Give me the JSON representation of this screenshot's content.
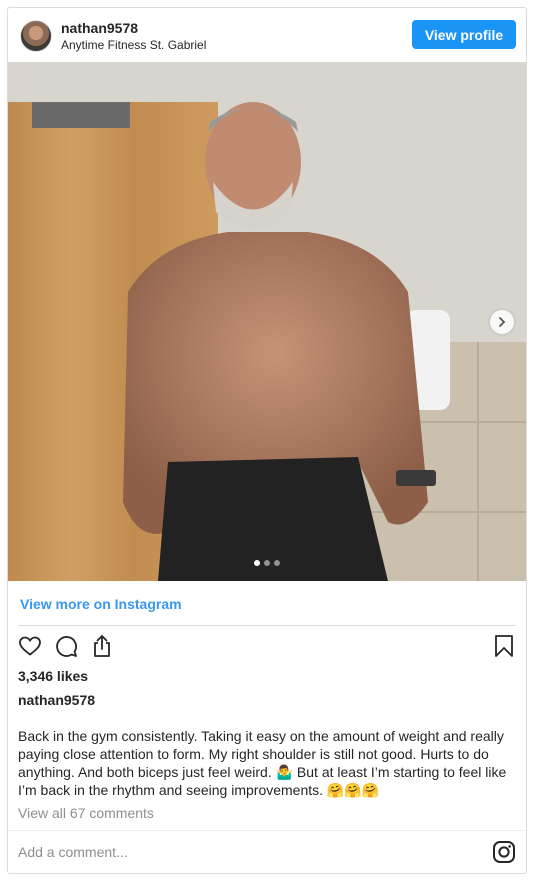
{
  "header": {
    "username": "nathan9578",
    "location": "Anytime Fitness St. Gabriel",
    "view_profile_label": "View profile"
  },
  "carousel": {
    "current_slide": 1,
    "total_slides": 3
  },
  "view_more_label": "View more on Instagram",
  "likes": "3,346 likes",
  "post": {
    "username": "nathan9578",
    "caption": "Back in the gym consistently. Taking it easy on the amount of weight and really paying close attention to form. My right shoulder is still not good. Hurts to do anything. And both biceps just feel weird. 🤷‍♂️ But at least I’m starting to feel like I’m back in the rhythm and seeing improvements. 🤗🤗🤗"
  },
  "comments_link": "View all 67 comments",
  "comment_placeholder": "Add a comment...",
  "colors": {
    "accent": "#1a95f5",
    "link": "#3897f0",
    "muted": "#8e8e8e"
  },
  "icons": [
    "heart-icon",
    "comment-icon",
    "share-icon",
    "bookmark-icon",
    "instagram-icon",
    "chevron-right-icon"
  ]
}
